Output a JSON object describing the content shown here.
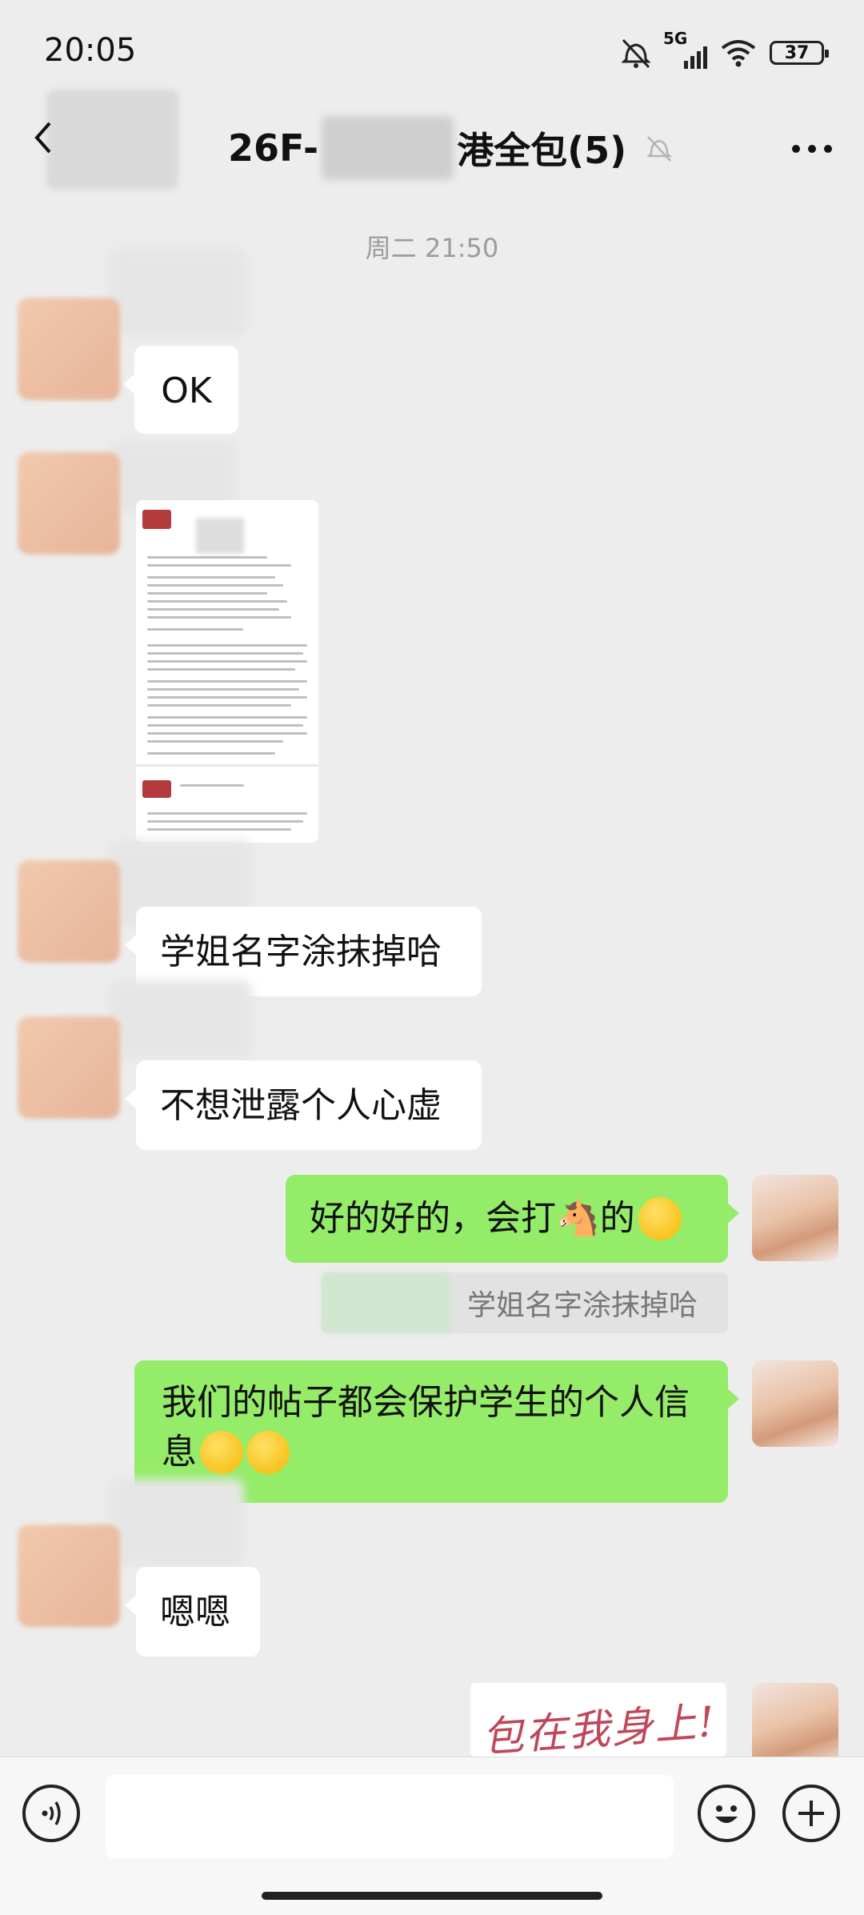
{
  "status_bar": {
    "time": "20:05",
    "network": "5G",
    "battery": "37"
  },
  "nav": {
    "title_prefix": "26F-",
    "title_suffix": "港全包(5)",
    "back_icon": "chevron-left-icon",
    "mute_icon": "bell-off-icon",
    "more_icon": "more-dots-icon"
  },
  "chat": {
    "timestamp": "周二 21:50",
    "messages": [
      {
        "from": "peer",
        "type": "text",
        "text": "OK"
      },
      {
        "from": "peer",
        "type": "document"
      },
      {
        "from": "peer",
        "type": "text",
        "text": "学姐名字涂抹掉哈"
      },
      {
        "from": "peer",
        "type": "text",
        "text": "不想泄露个人心虚"
      },
      {
        "from": "self",
        "type": "text",
        "text": "好的好的，会打🐴的",
        "quote": "学姐名字涂抹掉哈"
      },
      {
        "from": "self",
        "type": "text",
        "text_line1": "我们的帖子都会保护学生的个人信",
        "text_line2": "息"
      },
      {
        "from": "peer",
        "type": "text",
        "text": "嗯嗯"
      },
      {
        "from": "self",
        "type": "sticker",
        "text": "包在我身上!"
      }
    ]
  },
  "input": {
    "placeholder": "",
    "voice_icon": "voice-icon",
    "emoji_icon": "emoji-icon",
    "add_icon": "plus-icon"
  },
  "colors": {
    "background": "#ededed",
    "self_bubble": "#95ec69",
    "peer_bubble": "#ffffff"
  }
}
